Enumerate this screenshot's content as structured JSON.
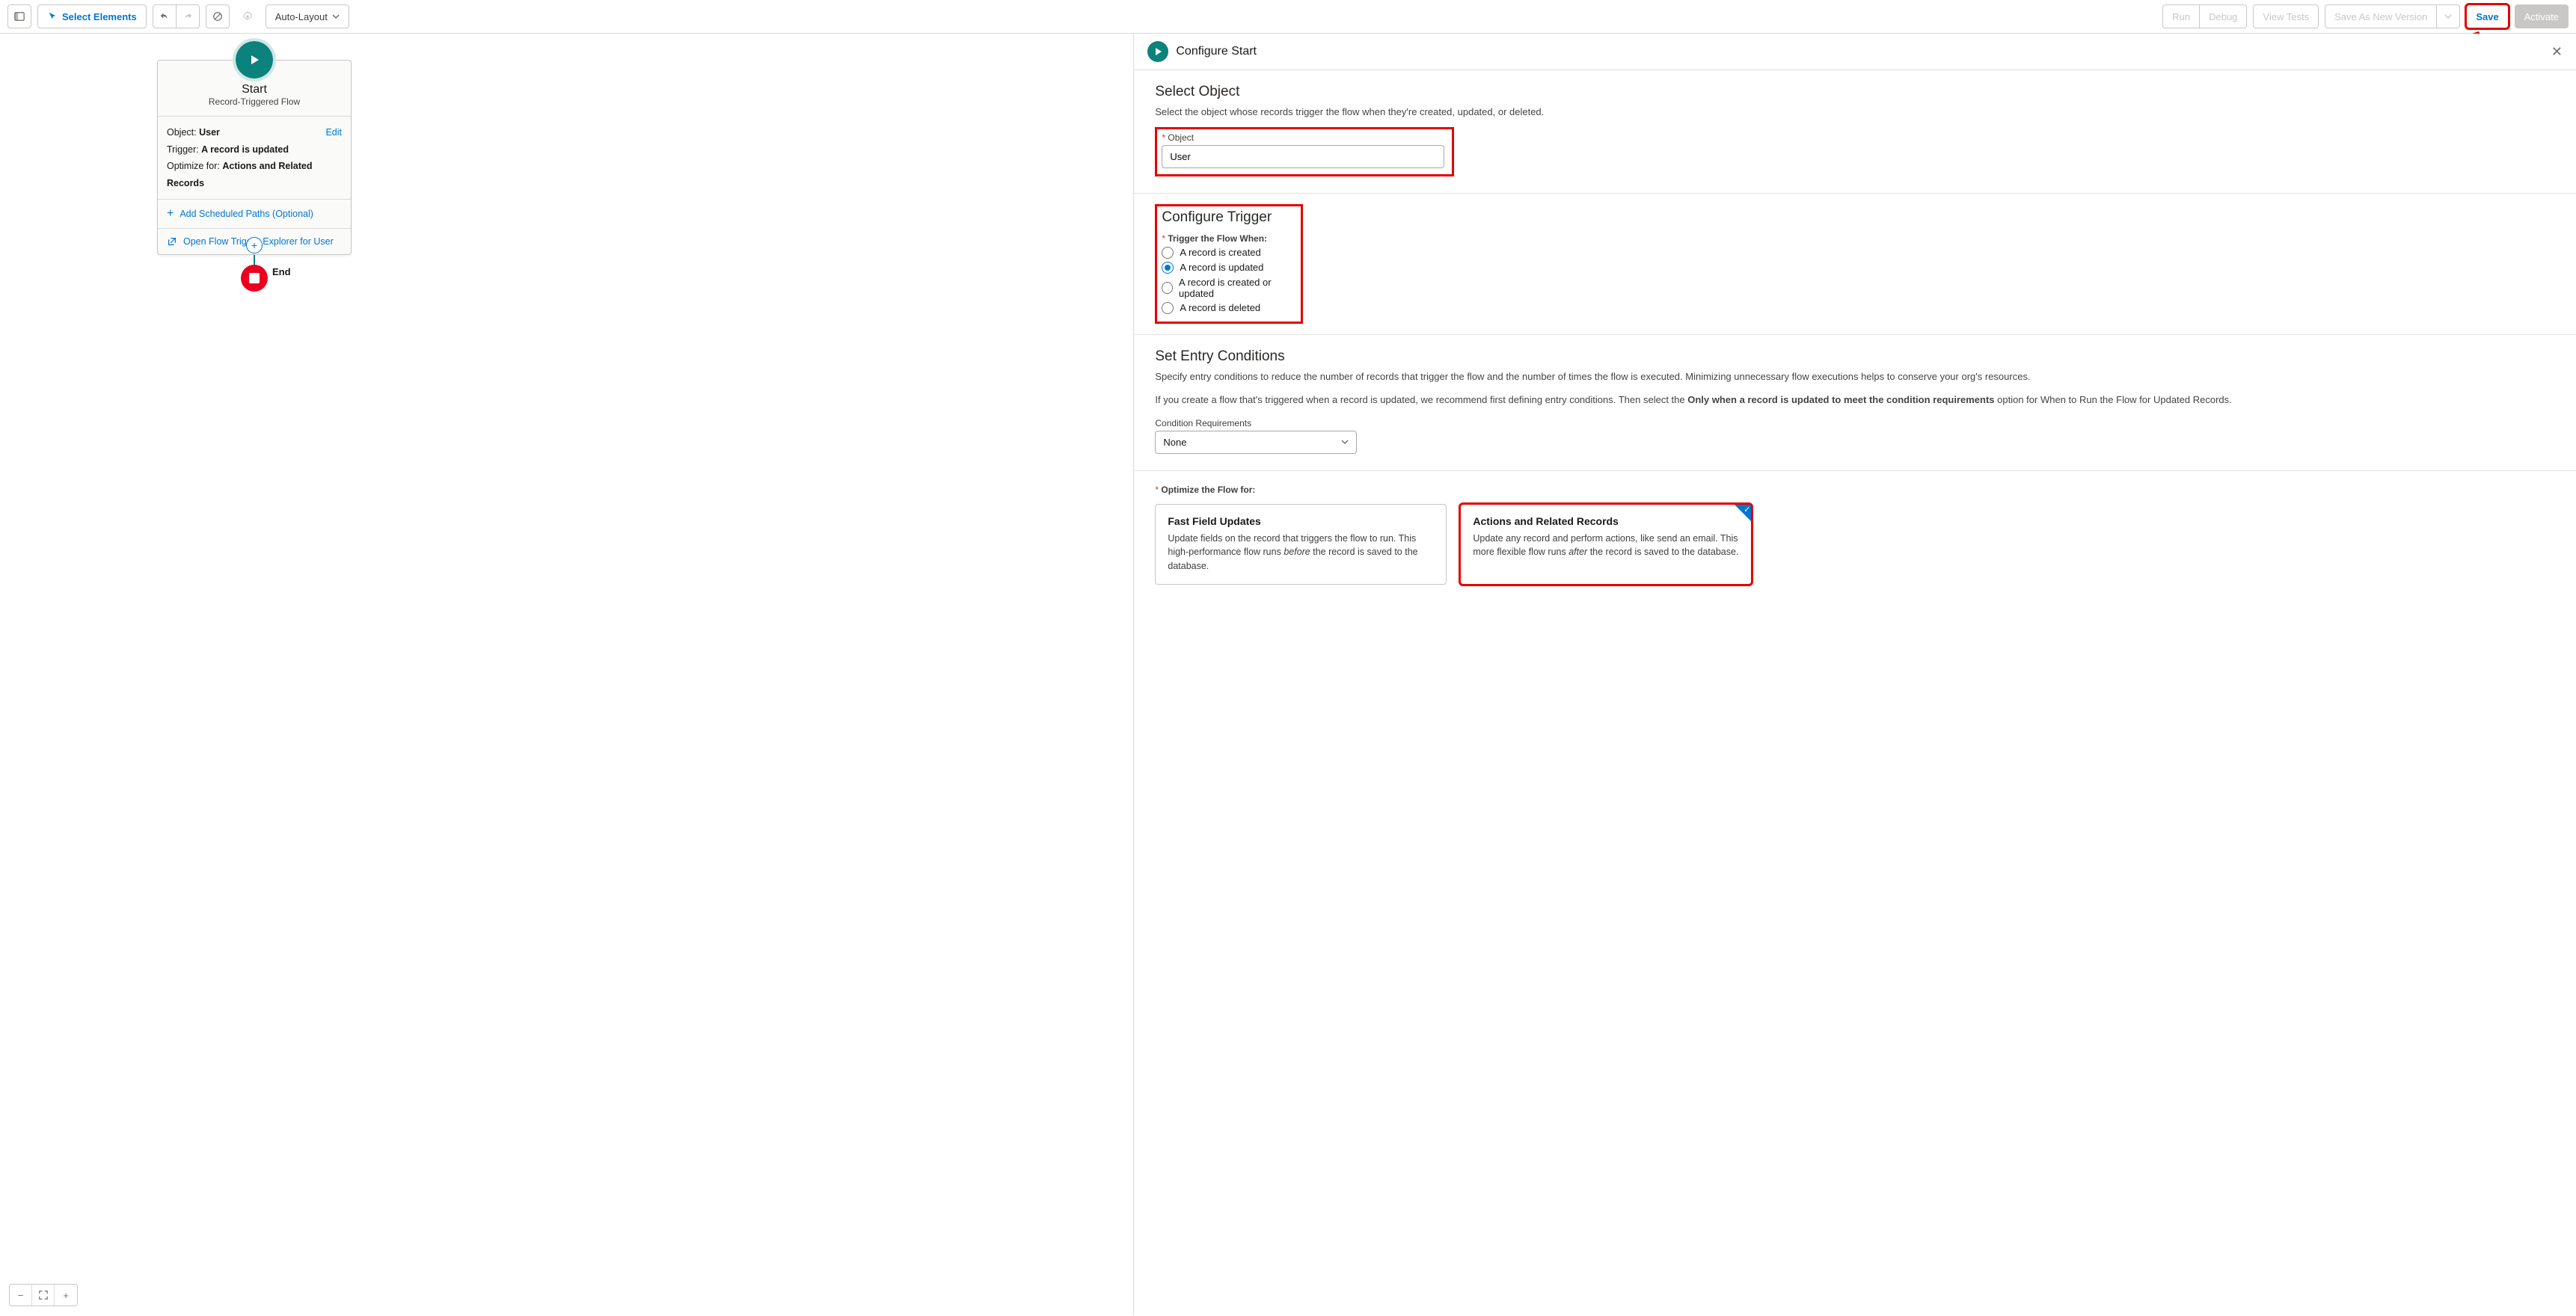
{
  "toolbar": {
    "select_elements": "Select Elements",
    "layout_mode": "Auto-Layout",
    "run": "Run",
    "debug": "Debug",
    "view_tests": "View Tests",
    "save_as_new": "Save As New Version",
    "save": "Save",
    "activate": "Activate"
  },
  "canvas": {
    "start_title": "Start",
    "start_subtitle": "Record-Triggered Flow",
    "edit": "Edit",
    "object_label": "Object:",
    "object_value": "User",
    "trigger_label": "Trigger:",
    "trigger_value": "A record is updated",
    "optimize_label": "Optimize for:",
    "optimize_value": "Actions and Related Records",
    "add_scheduled": "Add Scheduled Paths (Optional)",
    "open_explorer": "Open Flow Trigger Explorer for User",
    "end_label": "End"
  },
  "panel": {
    "header": "Configure Start",
    "select_object": {
      "title": "Select Object",
      "desc": "Select the object whose records trigger the flow when they're created, updated, or deleted.",
      "label": "Object",
      "value": "User"
    },
    "trigger": {
      "title": "Configure Trigger",
      "label": "Trigger the Flow When:",
      "opt_created": "A record is created",
      "opt_updated": "A record is updated",
      "opt_created_updated": "A record is created or updated",
      "opt_deleted": "A record is deleted"
    },
    "entry": {
      "title": "Set Entry Conditions",
      "desc1": "Specify entry conditions to reduce the number of records that trigger the flow and the number of times the flow is executed. Minimizing unnecessary flow executions helps to conserve your org's resources.",
      "desc2a": "If you create a flow that's triggered when a record is updated, we recommend first defining entry conditions. Then select the ",
      "desc2b": "Only when a record is updated to meet the condition requirements",
      "desc2c": " option for When to Run the Flow for Updated Records.",
      "cond_label": "Condition Requirements",
      "cond_value": "None"
    },
    "optimize": {
      "label": "Optimize the Flow for:",
      "fast_title": "Fast Field Updates",
      "fast_desc_a": "Update fields on the record that triggers the flow to run. This high-performance flow runs ",
      "fast_desc_b": "before",
      "fast_desc_c": " the record is saved to the database.",
      "actions_title": "Actions and Related Records",
      "actions_desc_a": "Update any record and perform actions, like send an email. This more flexible flow runs ",
      "actions_desc_b": "after",
      "actions_desc_c": " the record is saved to the database."
    }
  }
}
